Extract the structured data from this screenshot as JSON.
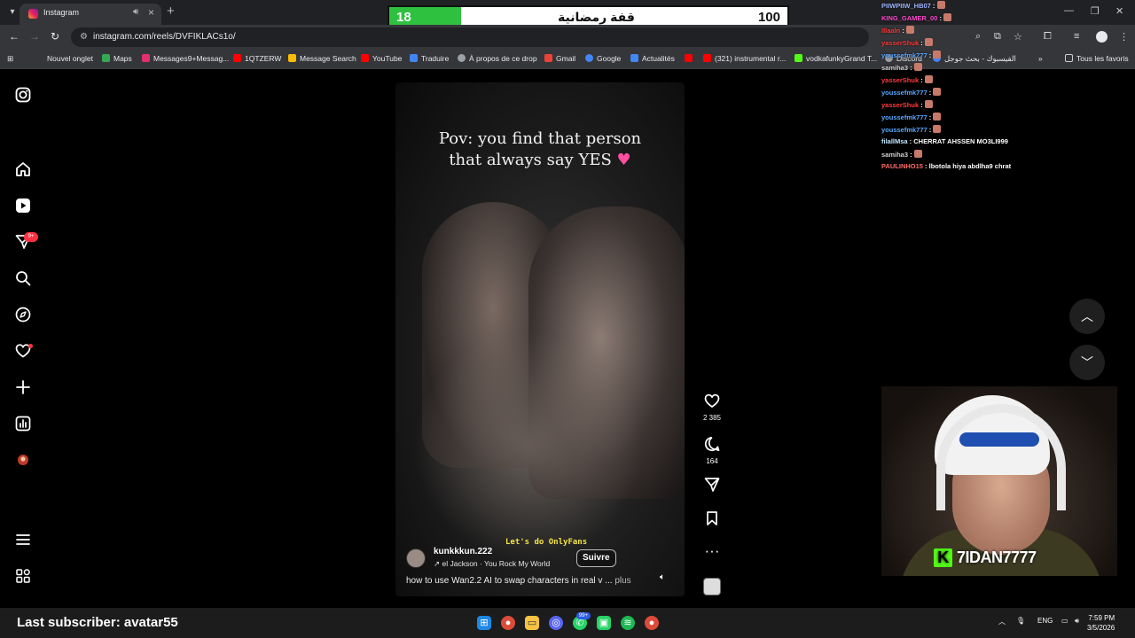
{
  "browser": {
    "tab_title": "Instagram",
    "url": "instagram.com/reels/DVFIKLACs1o/",
    "bookmarks": [
      {
        "label": "Nouvel onglet",
        "icon": "new-tab-icon",
        "color": "#35363a"
      },
      {
        "label": "Maps",
        "icon": "maps-icon",
        "color": "#34a853"
      },
      {
        "label": "Messages9+Messag...",
        "icon": "instagram-icon",
        "color": "#e1306c"
      },
      {
        "label": "1QTZERW",
        "icon": "youtube-icon",
        "color": "#ff0000"
      },
      {
        "label": "Message Search",
        "icon": "chart-icon",
        "color": "#fbbc04"
      },
      {
        "label": "YouTube",
        "icon": "youtube-icon",
        "color": "#ff0000"
      },
      {
        "label": "Traduire",
        "icon": "translate-icon",
        "color": "#4285f4"
      },
      {
        "label": "À propos de ce drop",
        "icon": "globe-icon",
        "color": "#9aa0a6"
      },
      {
        "label": "Gmail",
        "icon": "gmail-icon",
        "color": "#ea4335"
      },
      {
        "label": "Google",
        "icon": "google-icon",
        "color": "#4285f4"
      },
      {
        "label": "Actualités",
        "icon": "news-icon",
        "color": "#4285f4"
      },
      {
        "label": "",
        "icon": "youtube-icon",
        "color": "#ff0000"
      },
      {
        "label": "(321) instrumental r...",
        "icon": "youtube-icon",
        "color": "#ff0000"
      },
      {
        "label": "vodkafunkyGrand T...",
        "icon": "kick-icon",
        "color": "#53fc18"
      },
      {
        "label": "Discord",
        "icon": "globe-icon",
        "color": "#9aa0a6"
      },
      {
        "label": "الفيسبوك - بحث جوجل",
        "icon": "google-icon",
        "color": "#4285f4"
      }
    ],
    "all_bookmarks_label": "Tous les favoris"
  },
  "overlay": {
    "goal_current": "18",
    "goal_label": "قفة رمضانية",
    "goal_max": "100",
    "goal_fraction": 0.18,
    "fill_color": "#2ec13f"
  },
  "sidebar": {
    "notifications_badge": "9+"
  },
  "reel": {
    "caption_line1": "Pov: you find that person",
    "caption_line2": "that always say YES",
    "subtitle": "Let's do OnlyFans",
    "username": "kunkkkun.222",
    "music": "el Jackson · You Rock My World",
    "follow_label": "Suivre",
    "description": "how to use Wan2.2 AI to swap characters in real v ...",
    "more_label": "plus",
    "likes": "2 385",
    "comments": "164"
  },
  "chat": [
    {
      "user": "PIIWPIIW_HB07",
      "msg": "",
      "color": "#9fb3ff"
    },
    {
      "user": "KING_GAMER_00",
      "msg": "",
      "color": "#ff4ad1"
    },
    {
      "user": "lllaaln",
      "msg": "",
      "color": "#ff3b3b"
    },
    {
      "user": "yasserShuk",
      "msg": "",
      "color": "#ff3b3b"
    },
    {
      "user": "youssefmk777",
      "msg": "",
      "color": "#5aa8ff"
    },
    {
      "user": "samiha3",
      "msg": "",
      "color": "#d0d0d0"
    },
    {
      "user": "yasserShuk",
      "msg": "",
      "color": "#ff3b3b"
    },
    {
      "user": "youssefmk777",
      "msg": "",
      "color": "#5aa8ff"
    },
    {
      "user": "yasserShuk",
      "msg": "",
      "color": "#ff3b3b"
    },
    {
      "user": "youssefmk777",
      "msg": "",
      "color": "#5aa8ff"
    },
    {
      "user": "youssefmk777",
      "msg": "",
      "color": "#5aa8ff"
    },
    {
      "user": "filallMsa",
      "msg": "CHERRAT AHSSEN MO3LI999",
      "color": "#bfe8ff"
    },
    {
      "user": "samiha3",
      "msg": "",
      "color": "#d0d0d0"
    },
    {
      "user": "PAULINHO15",
      "msg": "lbotola hiya abdlha9 chrat",
      "color": "#ff6a6a"
    }
  ],
  "webcam": {
    "streamer_name": "7IDAN7777",
    "brand_color": "#53fc18"
  },
  "bottom": {
    "last_subscriber": "Last subscriber: avatar55",
    "language": "ENG",
    "time": "7:59 PM",
    "date": "3/5/2026",
    "discord_badge": "99+"
  }
}
